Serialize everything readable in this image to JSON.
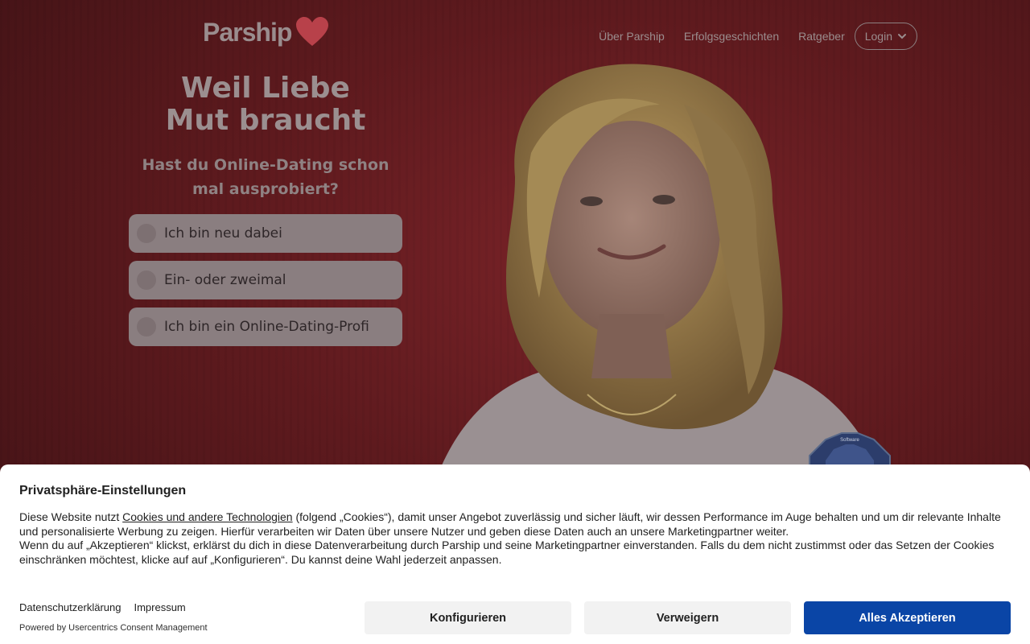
{
  "header": {
    "logo_text": "Parship",
    "nav": [
      {
        "label": "Über Parship"
      },
      {
        "label": "Erfolgsgeschichten"
      },
      {
        "label": "Ratgeber"
      }
    ],
    "login_label": "Login"
  },
  "hero": {
    "headline_line1": "Weil Liebe",
    "headline_line2": "Mut braucht",
    "question": "Hast du Online-Dating schon mal ausprobiert?",
    "options": [
      {
        "label": "Ich bin neu dabei"
      },
      {
        "label": "Ein- oder zweimal"
      },
      {
        "label": "Ich bin ein Online-Dating-Profi"
      }
    ],
    "badge_text": "Software"
  },
  "consent": {
    "title": "Privatsphäre-Einstellungen",
    "text_before_link": "Diese Website nutzt ",
    "link_text": "Cookies und andere Technologien",
    "text_after_link": " (folgend „Cookies“), damit unser Angebot zuverlässig und sicher läuft, wir dessen Performance im Auge behalten und um dir relevante Inhalte und personalisierte Werbung zu zeigen. Hierfür verarbeiten wir Daten über unsere Nutzer und geben diese Daten auch an unsere Marketingpartner weiter.",
    "text_second": "Wenn du auf „Akzeptieren“ klickst, erklärst du dich in diese Datenverarbeitung durch Parship und seine Marketingpartner einverstanden. Falls du dem nicht zustimmst oder das Setzen der Cookies einschränken möchtest, klicke auf auf „Konfigurieren“. Du kannst deine Wahl jederzeit anpassen.",
    "privacy_link": "Datenschutzerklärung",
    "imprint_link": "Impressum",
    "powered_by": "Powered by Usercentrics Consent Management",
    "configure_label": "Konfigurieren",
    "deny_label": "Verweigern",
    "accept_label": "Alles Akzeptieren"
  },
  "colors": {
    "accent_blue": "#0a45a6",
    "brand_red": "#c8262f"
  }
}
